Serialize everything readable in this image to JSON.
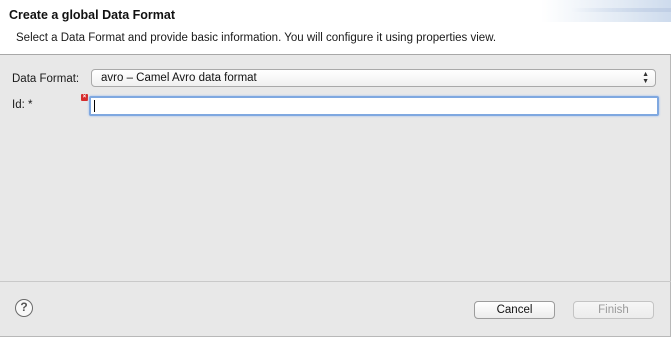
{
  "header": {
    "title": "Create a global Data Format",
    "description": "Select a Data Format and provide basic information. You will configure it using properties view."
  },
  "form": {
    "data_format_label": "Data Format:",
    "data_format_value": "avro – Camel Avro data format",
    "id_label": "Id: *",
    "id_value": "",
    "error_icon": "error-icon"
  },
  "footer": {
    "help_icon": "question-mark-icon",
    "help_glyph": "?",
    "cancel_label": "Cancel",
    "finish_label": "Finish"
  },
  "colors": {
    "header_bg": "#ffffff",
    "body_bg": "#e8e8e8",
    "focus_ring": "#7fa8e0",
    "error": "#d62c2c",
    "disabled_text": "#9a9a9a"
  }
}
